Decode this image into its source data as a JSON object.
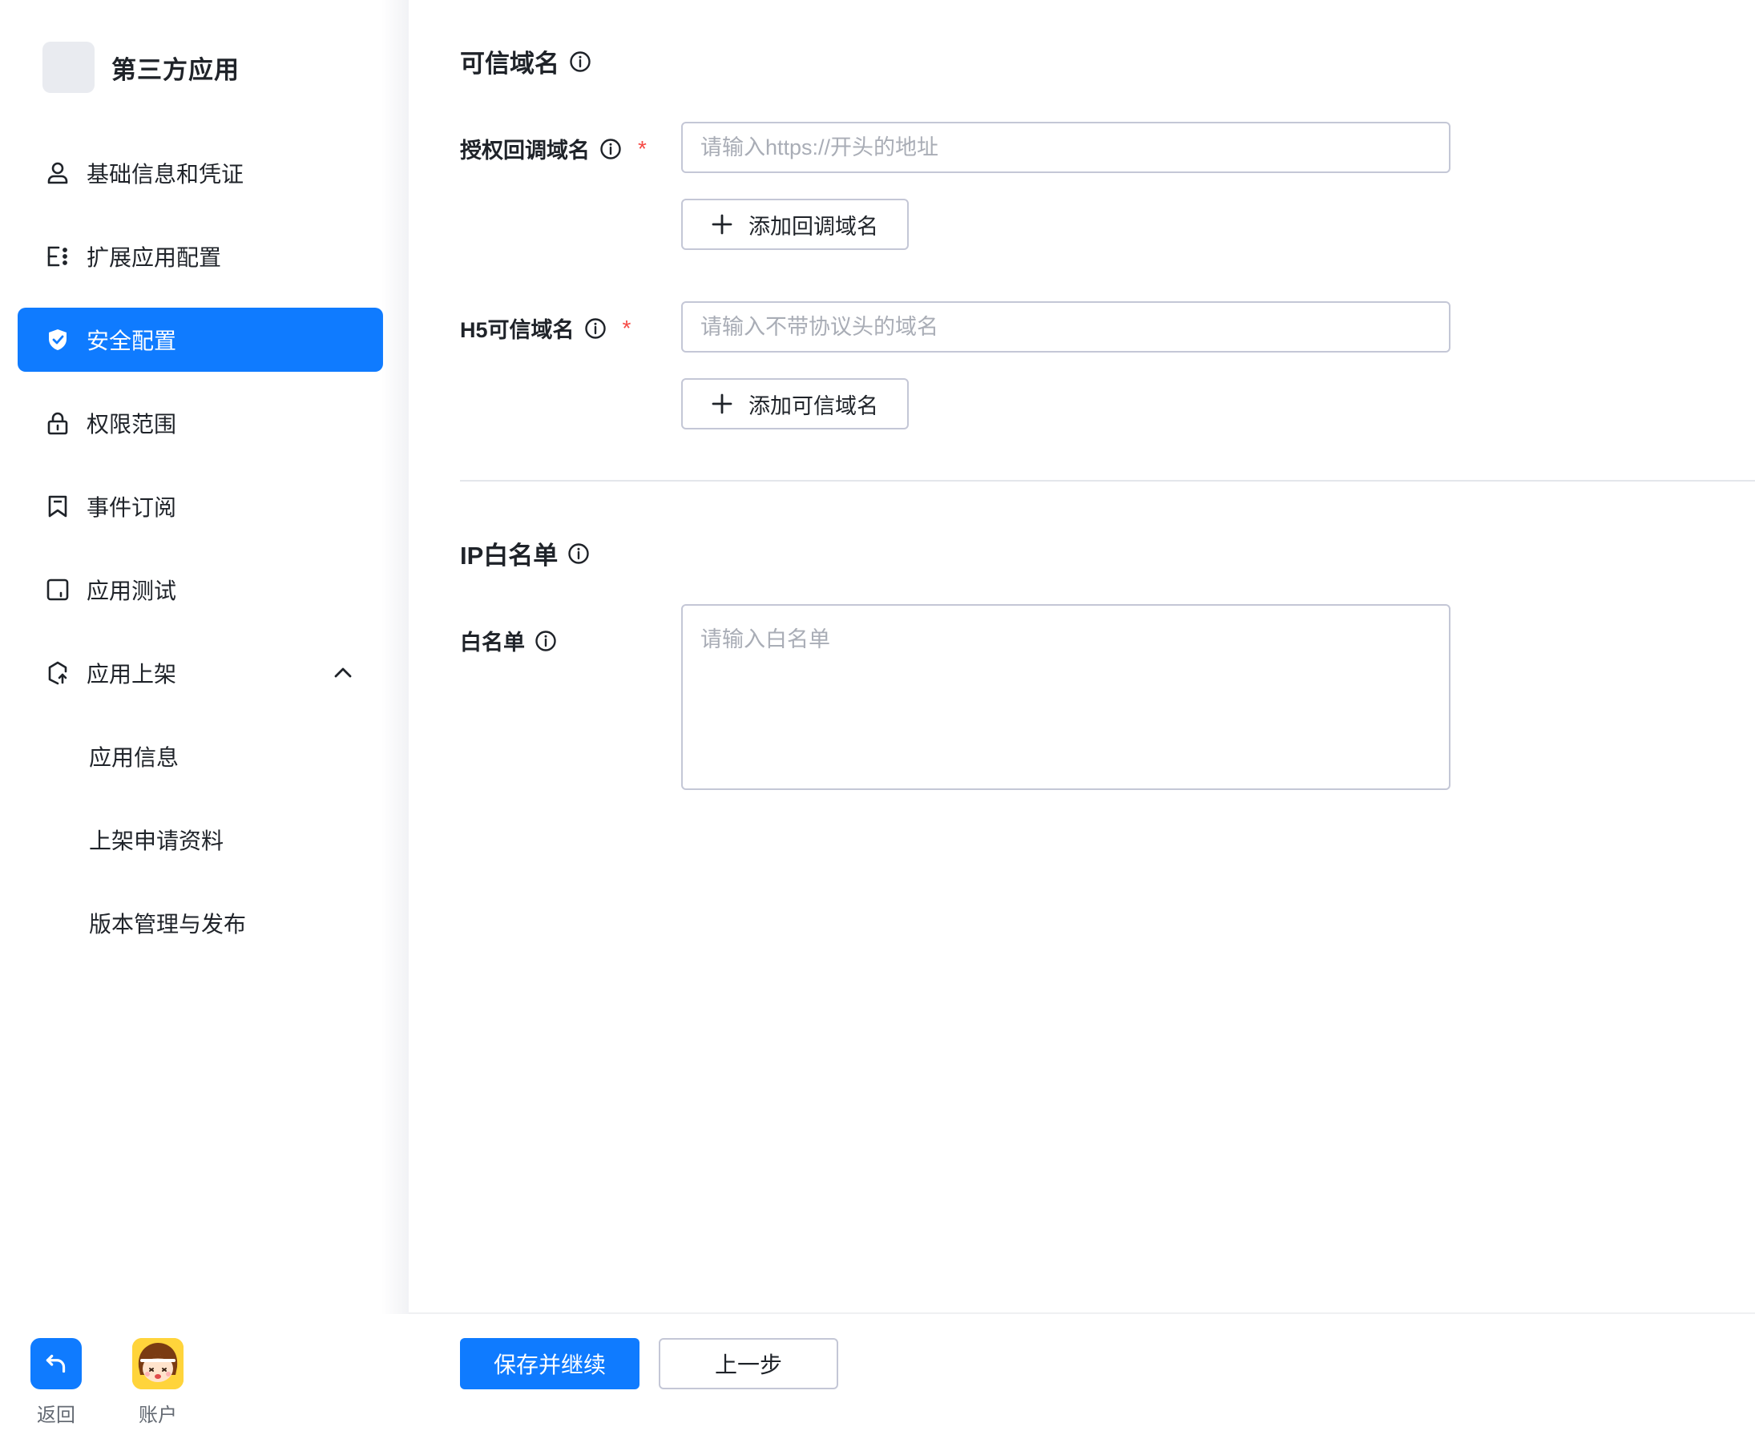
{
  "app": {
    "name": "第三方应用"
  },
  "sidebar": {
    "items": [
      {
        "label": "基础信息和凭证",
        "icon": "user-icon"
      },
      {
        "label": "扩展应用配置",
        "icon": "extension-config-icon"
      },
      {
        "label": "安全配置",
        "icon": "shield-icon",
        "active": true
      },
      {
        "label": "权限范围",
        "icon": "lock-icon"
      },
      {
        "label": "事件订阅",
        "icon": "bookmark-icon"
      },
      {
        "label": "应用测试",
        "icon": "test-window-icon"
      },
      {
        "label": "应用上架",
        "icon": "publish-icon",
        "expanded": true
      }
    ],
    "subitems": [
      {
        "label": "应用信息"
      },
      {
        "label": "上架申请资料"
      },
      {
        "label": "版本管理与发布"
      }
    ],
    "footer": {
      "back_label": "返回",
      "account_label": "账户"
    }
  },
  "sections": {
    "trusted_domains": {
      "title": "可信域名",
      "callback": {
        "label": "授权回调域名",
        "required_mark": "*",
        "placeholder": "请输入https://开头的地址",
        "value": "",
        "add_button": "添加回调域名"
      },
      "h5": {
        "label": "H5可信域名",
        "required_mark": "*",
        "placeholder": "请输入不带协议头的域名",
        "value": "",
        "add_button": "添加可信域名"
      }
    },
    "ip_whitelist": {
      "title": "IP白名单",
      "whitelist": {
        "label": "白名单",
        "placeholder": "请输入白名单",
        "value": ""
      }
    }
  },
  "actions": {
    "save_continue": "保存并继续",
    "previous": "上一步"
  },
  "colors": {
    "primary": "#0f7bff",
    "required": "#f54a45",
    "border": "#c4c7d6"
  }
}
